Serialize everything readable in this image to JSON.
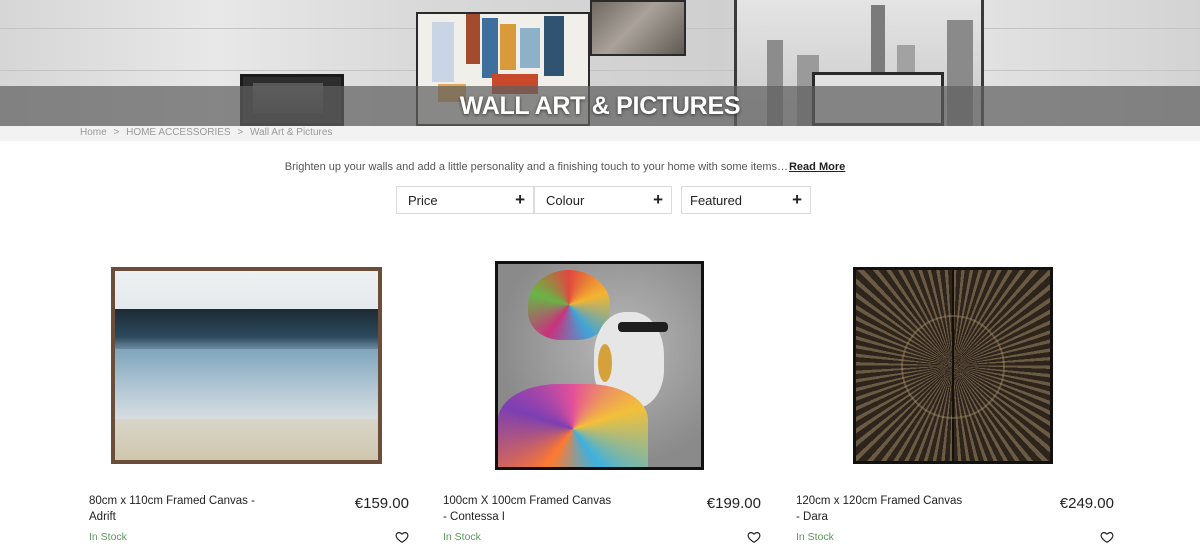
{
  "hero": {
    "title": "WALL ART & PICTURES"
  },
  "breadcrumb": {
    "items": [
      "Home",
      "HOME ACCESSORIES",
      "Wall Art & Pictures"
    ],
    "separator": ">"
  },
  "intro": {
    "text": "Brighten up your walls and add a little personality and a finishing touch to your home with some items…",
    "read_more": "Read More"
  },
  "filters": [
    {
      "label": "Price",
      "icon": "plus-icon"
    },
    {
      "label": "Colour",
      "icon": "plus-icon"
    },
    {
      "label": "Featured",
      "icon": "plus-icon"
    }
  ],
  "products": [
    {
      "name": "80cm x 110cm Framed Canvas - Adrift",
      "price": "€159.00",
      "stock": "In Stock",
      "icon": "heart-icon"
    },
    {
      "name": "100cm X 100cm Framed Canvas - Contessa I",
      "price": "€199.00",
      "stock": "In Stock",
      "icon": "heart-icon"
    },
    {
      "name": "120cm x 120cm Framed Canvas - Dara",
      "price": "€249.00",
      "stock": "In Stock",
      "icon": "heart-icon"
    }
  ],
  "colors": {
    "in_stock": "#5a9a5a",
    "hero_band": "#5f5f5f"
  }
}
